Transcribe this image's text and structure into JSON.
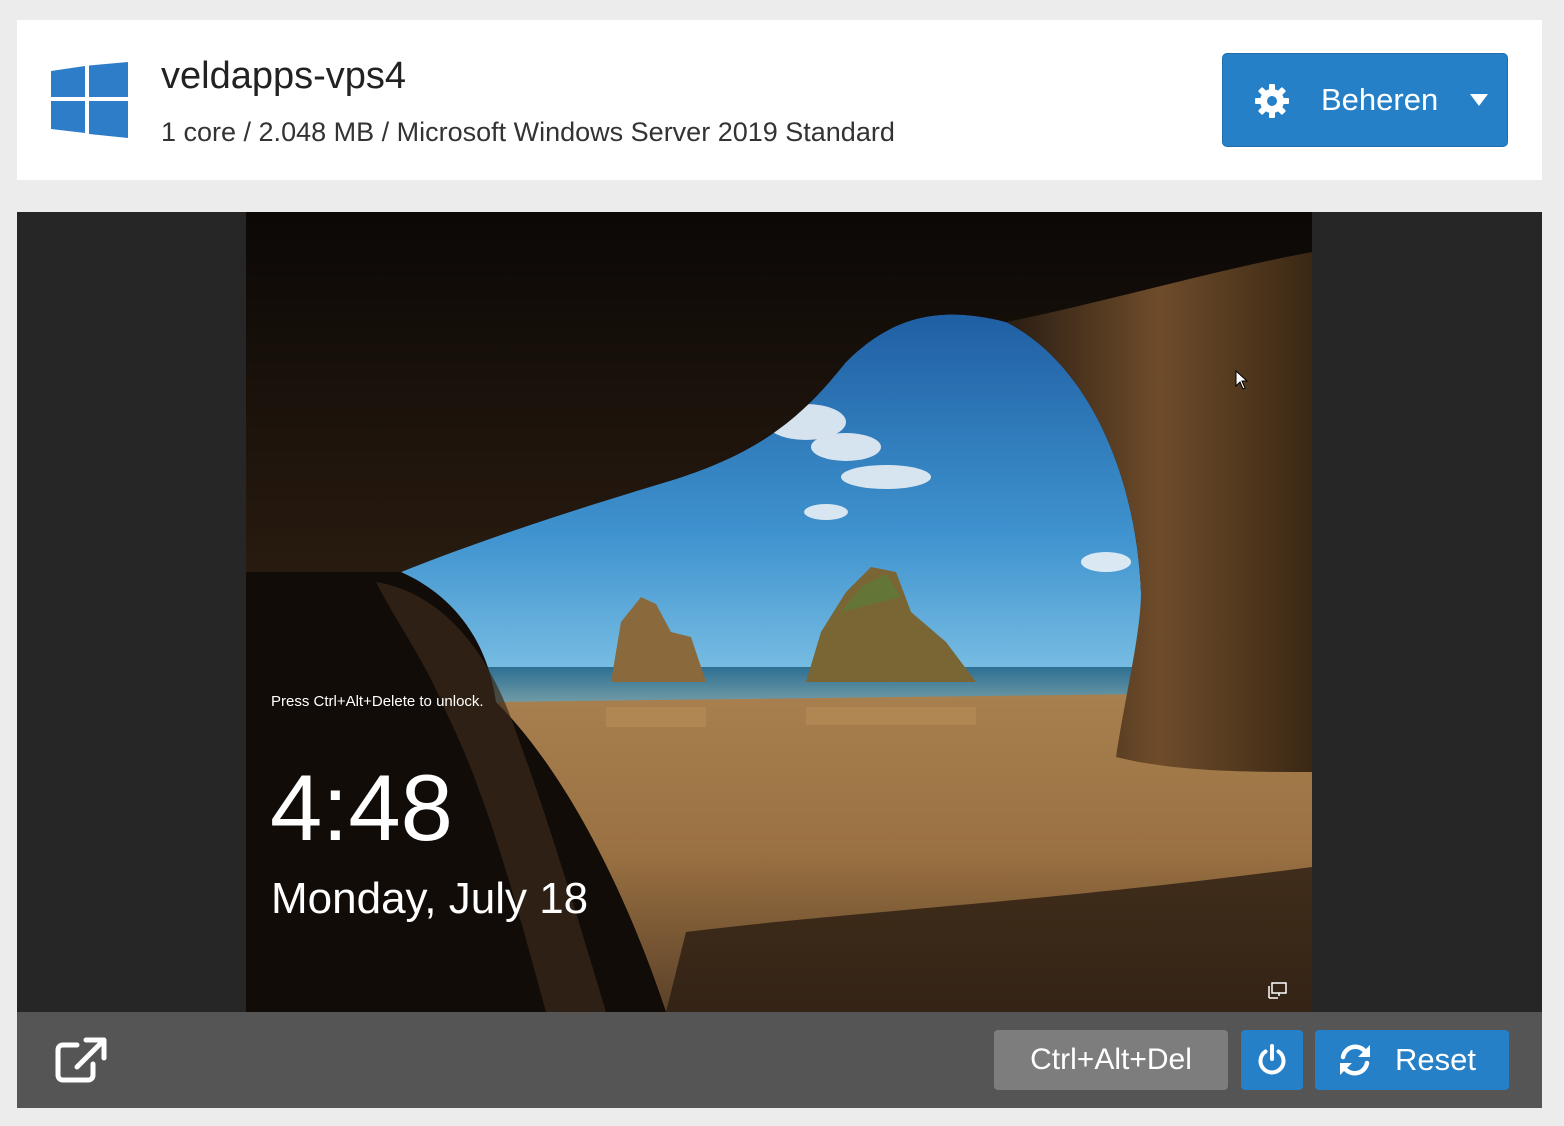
{
  "server": {
    "name": "veldapps-vps4",
    "specs": "1 core / 2.048 MB / Microsoft Windows Server 2019 Standard",
    "os_icon": "windows-logo-icon"
  },
  "manage_menu": {
    "label": "Beheren",
    "icon": "gear-icon"
  },
  "console": {
    "lock_screen": {
      "hint": "Press Ctrl+Alt+Delete to unlock.",
      "time": "4:48",
      "date": "Monday, July 18"
    }
  },
  "toolbar": {
    "popout_icon": "external-link-icon",
    "ctrl_alt_del_label": "Ctrl+Alt+Del",
    "power_icon": "power-icon",
    "reset_label": "Reset",
    "reset_icon": "refresh-icon"
  },
  "colors": {
    "accent": "#2580c7",
    "windows_blue": "#2d7dc8",
    "toolbar": "#555555",
    "console_frame": "#262626",
    "page_background": "#ececec"
  }
}
